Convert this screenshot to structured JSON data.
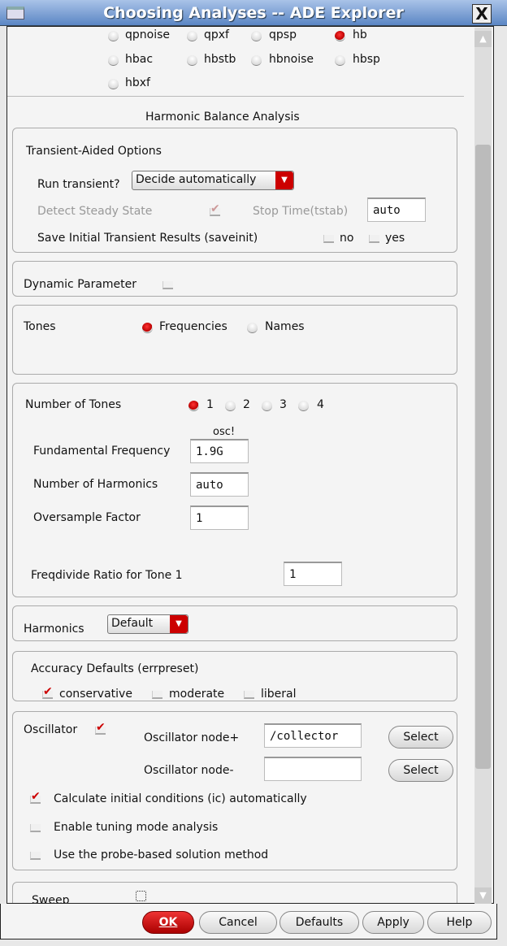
{
  "window": {
    "title": "Choosing Analyses -- ADE Explorer",
    "close": "X"
  },
  "analysis_types": [
    {
      "label": "qpnoise",
      "selected": false
    },
    {
      "label": "qpxf",
      "selected": false
    },
    {
      "label": "qpsp",
      "selected": false
    },
    {
      "label": "hb",
      "selected": true
    },
    {
      "label": "hbac",
      "selected": false
    },
    {
      "label": "hbstb",
      "selected": false
    },
    {
      "label": "hbnoise",
      "selected": false
    },
    {
      "label": "hbsp",
      "selected": false
    },
    {
      "label": "hbxf",
      "selected": false
    }
  ],
  "section_title": "Harmonic Balance Analysis",
  "transient": {
    "title": "Transient-Aided Options",
    "run_label": "Run transient?",
    "run_value": "Decide automatically",
    "detect_label": "Detect Steady State",
    "detect_checked": true,
    "stop_label": "Stop Time(tstab)",
    "stop_value": "auto",
    "saveinit_label": "Save Initial Transient Results (saveinit)",
    "no": "no",
    "yes": "yes"
  },
  "dynamic": {
    "label": "Dynamic Parameter"
  },
  "tones": {
    "label": "Tones",
    "frequencies": "Frequencies",
    "names": "Names"
  },
  "num_tones": {
    "label": "Number of Tones",
    "options": [
      "1",
      "2",
      "3",
      "4"
    ],
    "selected": "1",
    "col_header": "osc!",
    "fund_label": "Fundamental Frequency",
    "fund_value": "1.9G",
    "harm_label": "Number of Harmonics",
    "harm_value": "auto",
    "over_label": "Oversample Factor",
    "over_value": "1",
    "freqdiv_label": "Freqdivide Ratio for Tone 1",
    "freqdiv_value": "1"
  },
  "harmonics": {
    "label": "Harmonics",
    "value": "Default"
  },
  "accuracy": {
    "label": "Accuracy Defaults (errpreset)",
    "conservative": "conservative",
    "moderate": "moderate",
    "liberal": "liberal"
  },
  "oscillator": {
    "label": "Oscillator",
    "node_plus_label": "Oscillator node+",
    "node_plus_value": "/collector",
    "node_minus_label": "Oscillator node-",
    "node_minus_value": "",
    "select": "Select",
    "ic_label": "Calculate initial conditions (ic) automatically",
    "tuning_label": "Enable tuning mode analysis",
    "probe_label": "Use the probe-based solution method"
  },
  "sweep": {
    "label": "Sweep"
  },
  "buttons": {
    "ok": "OK",
    "cancel": "Cancel",
    "defaults": "Defaults",
    "apply": "Apply",
    "help": "Help"
  }
}
